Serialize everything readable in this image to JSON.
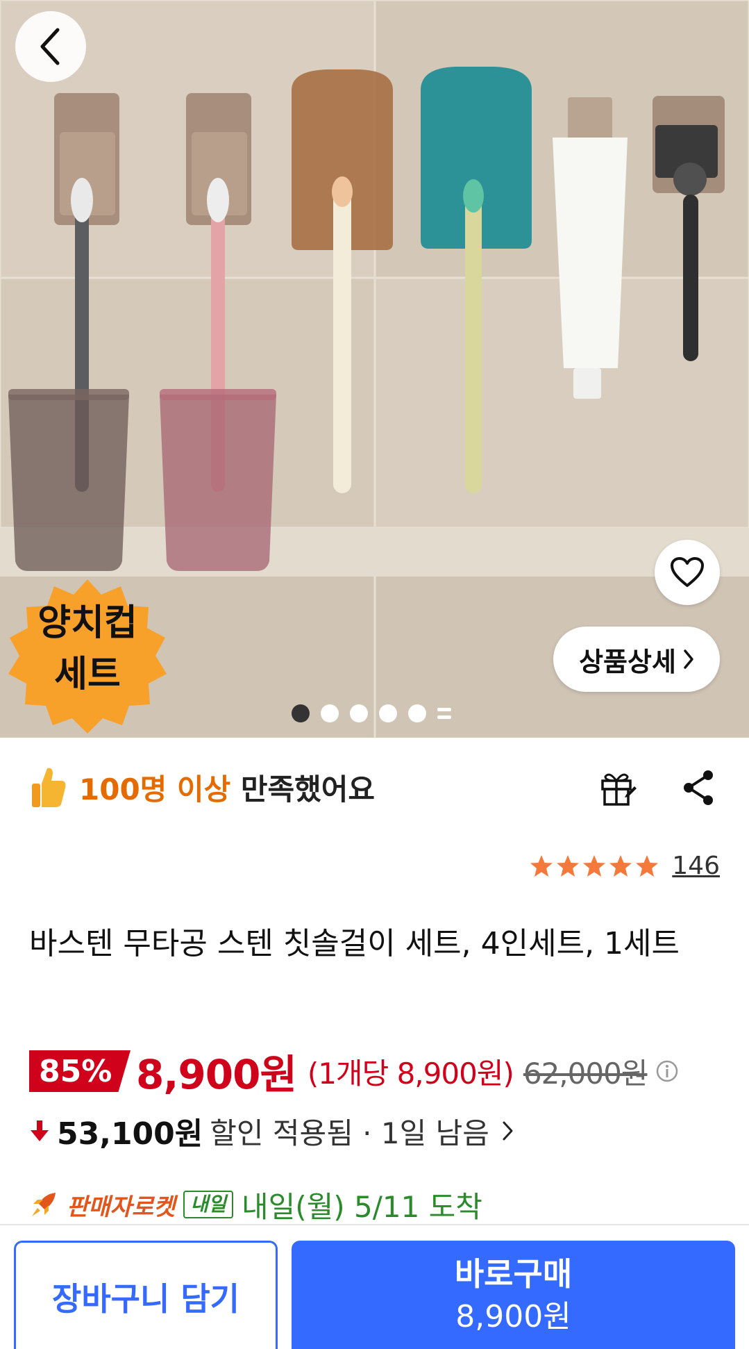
{
  "product_image": {
    "badge_line1": "양치컵",
    "badge_line2": "세트",
    "detail_button_label": "상품상세",
    "slides_total": 6,
    "slide_active": 1
  },
  "satisfaction": {
    "highlight": "100명 이상",
    "rest": "만족했어요"
  },
  "rating": {
    "stars": 5,
    "review_count": "146"
  },
  "product": {
    "title": "바스텐 무타공 스텐 칫솔걸이 세트, 4인세트, 1세트"
  },
  "price": {
    "discount_percent": "85%",
    "sale_price": "8,900원",
    "unit_price": "(1개당 8,900원)",
    "original_price": "62,000원",
    "discount_amount": "53,100원",
    "discount_note": "할인 적용됨 · 1일 남음"
  },
  "delivery": {
    "seller_rocket": "판매자로켓",
    "tomorrow_badge": "내일",
    "arrival": "내일(월) 5/11 도착"
  },
  "bottom_bar": {
    "cart_label": "장바구니 담기",
    "buy_label": "바로구매",
    "buy_price": "8,900원"
  },
  "colors": {
    "accent_blue": "#346aff",
    "sale_red": "#d0021b",
    "satisfaction_orange": "#e46b00",
    "delivery_green": "#2b8a2b",
    "star_orange": "#f5793a"
  }
}
